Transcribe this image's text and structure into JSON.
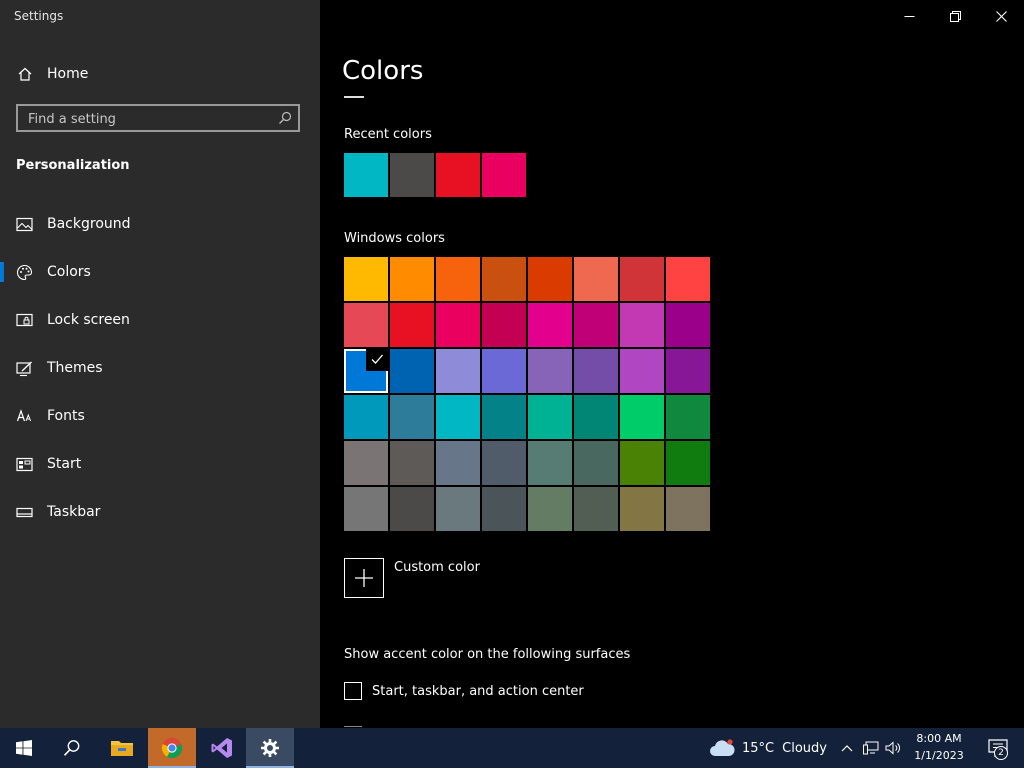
{
  "window": {
    "app_title": "Settings",
    "controls": {
      "minimize_icon": "minimize-icon",
      "restore_icon": "restore-icon",
      "close_icon": "close-icon"
    }
  },
  "sidebar": {
    "home_label": "Home",
    "search_placeholder": "Find a setting",
    "section_label": "Personalization",
    "items": [
      {
        "id": "background",
        "label": "Background",
        "icon": "image-icon",
        "active": false
      },
      {
        "id": "colors",
        "label": "Colors",
        "icon": "palette-icon",
        "active": true
      },
      {
        "id": "lock-screen",
        "label": "Lock screen",
        "icon": "lock-screen-icon",
        "active": false
      },
      {
        "id": "themes",
        "label": "Themes",
        "icon": "themes-icon",
        "active": false
      },
      {
        "id": "fonts",
        "label": "Fonts",
        "icon": "fonts-icon",
        "active": false
      },
      {
        "id": "start",
        "label": "Start",
        "icon": "start-icon",
        "active": false
      },
      {
        "id": "taskbar",
        "label": "Taskbar",
        "icon": "taskbar-icon",
        "active": false
      }
    ]
  },
  "main": {
    "title": "Colors",
    "recent_label": "Recent colors",
    "recent_colors": [
      "#00b7c3",
      "#4c4a48",
      "#e81123",
      "#ea005e"
    ],
    "windows_label": "Windows colors",
    "windows_colors": [
      [
        "#ffb900",
        "#ff8c00",
        "#f7630c",
        "#ca5010",
        "#da3b01",
        "#ef6950",
        "#d13438",
        "#ff4343"
      ],
      [
        "#e74856",
        "#e81123",
        "#ea005e",
        "#c30052",
        "#e3008c",
        "#bf0077",
        "#c239b3",
        "#9a0089"
      ],
      [
        "#0078d7",
        "#0063b1",
        "#8e8cd8",
        "#6b69d6",
        "#8764b8",
        "#744da9",
        "#b146c2",
        "#881798"
      ],
      [
        "#0099bc",
        "#2d7d9a",
        "#00b7c3",
        "#038387",
        "#00b294",
        "#018574",
        "#00cc6a",
        "#10893e"
      ],
      [
        "#7a7574",
        "#5d5a58",
        "#68768a",
        "#515c6b",
        "#567c73",
        "#486860",
        "#498205",
        "#107c10"
      ],
      [
        "#767676",
        "#4c4a48",
        "#69797e",
        "#4a5459",
        "#647c64",
        "#525e54",
        "#847545",
        "#7e735f"
      ]
    ],
    "selected_color": "#0078d7",
    "custom_color_label": "Custom color",
    "surfaces_label": "Show accent color on the following surfaces",
    "surfaces_option": "Start, taskbar, and action center"
  },
  "taskbar": {
    "weather_temp": "15°C",
    "weather_condition": "Cloudy",
    "time": "8:00 AM",
    "date": "1/1/2023",
    "notification_count": "2"
  }
}
